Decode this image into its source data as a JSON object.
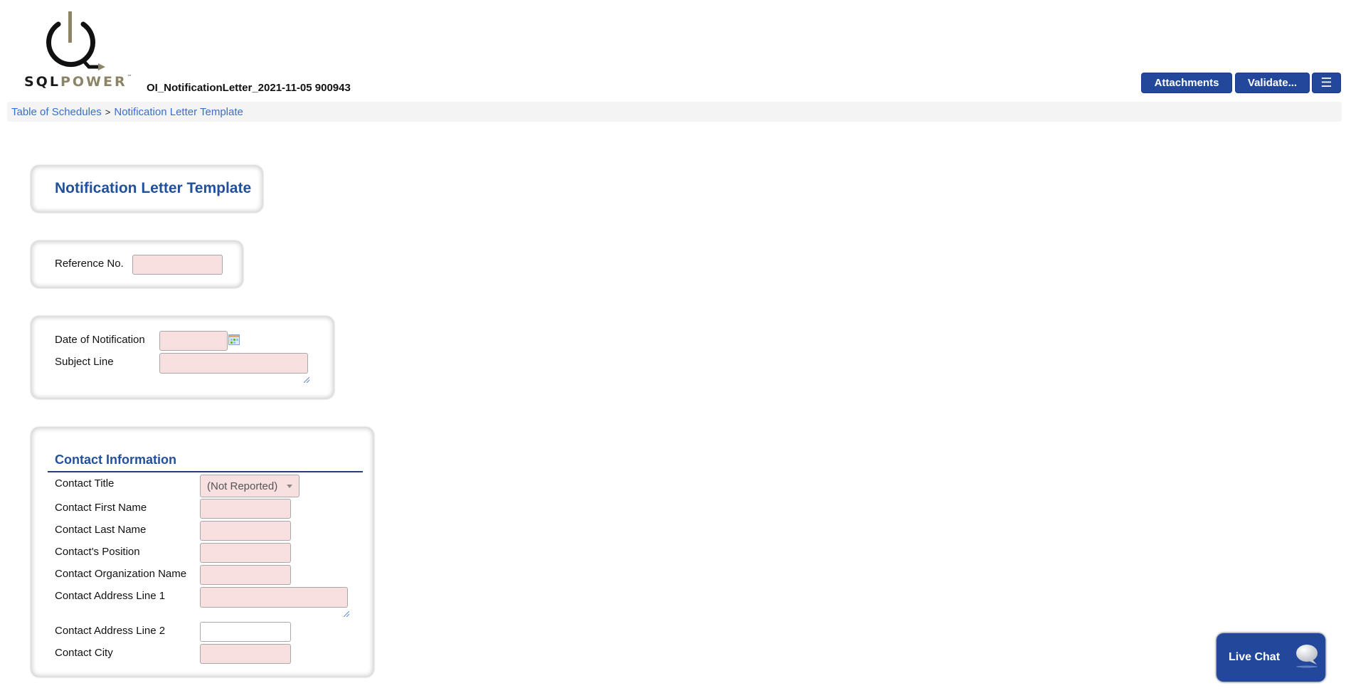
{
  "header": {
    "logo_text_sql": "SQL",
    "logo_text_power": "POWER",
    "logo_tm": "™",
    "document_title": "OI_NotificationLetter_2021-11-05 900943",
    "buttons": {
      "attachments": "Attachments",
      "validate": "Validate...",
      "menu_icon": "☰"
    }
  },
  "breadcrumb": {
    "items": [
      "Table of Schedules",
      "Notification Letter Template"
    ],
    "separator": ">"
  },
  "page": {
    "heading": "Notification Letter Template"
  },
  "reference_section": {
    "label": "Reference No.",
    "value": ""
  },
  "notification_section": {
    "date_label": "Date of Notification",
    "date_value": "",
    "subject_label": "Subject Line",
    "subject_value": ""
  },
  "contact_section": {
    "heading": "Contact Information",
    "fields": [
      {
        "label": "Contact Title",
        "type": "select",
        "value": "(Not Reported)"
      },
      {
        "label": "Contact First Name",
        "type": "text",
        "value": ""
      },
      {
        "label": "Contact Last Name",
        "type": "text",
        "value": ""
      },
      {
        "label": "Contact's Position",
        "type": "text",
        "value": ""
      },
      {
        "label": "Contact Organization Name",
        "type": "text",
        "value": ""
      },
      {
        "label": "Contact Address Line 1",
        "type": "textarea",
        "value": ""
      },
      {
        "label": "Contact Address Line 2",
        "type": "text",
        "value": ""
      },
      {
        "label": "Contact City",
        "type": "text",
        "value": ""
      }
    ]
  },
  "live_chat": {
    "label": "Live Chat"
  },
  "colors": {
    "primary": "#22479b",
    "heading": "#22509a",
    "link": "#3a6fc8",
    "required_field_bg": "#f8e0e0",
    "logo_accent": "#8b8467"
  }
}
